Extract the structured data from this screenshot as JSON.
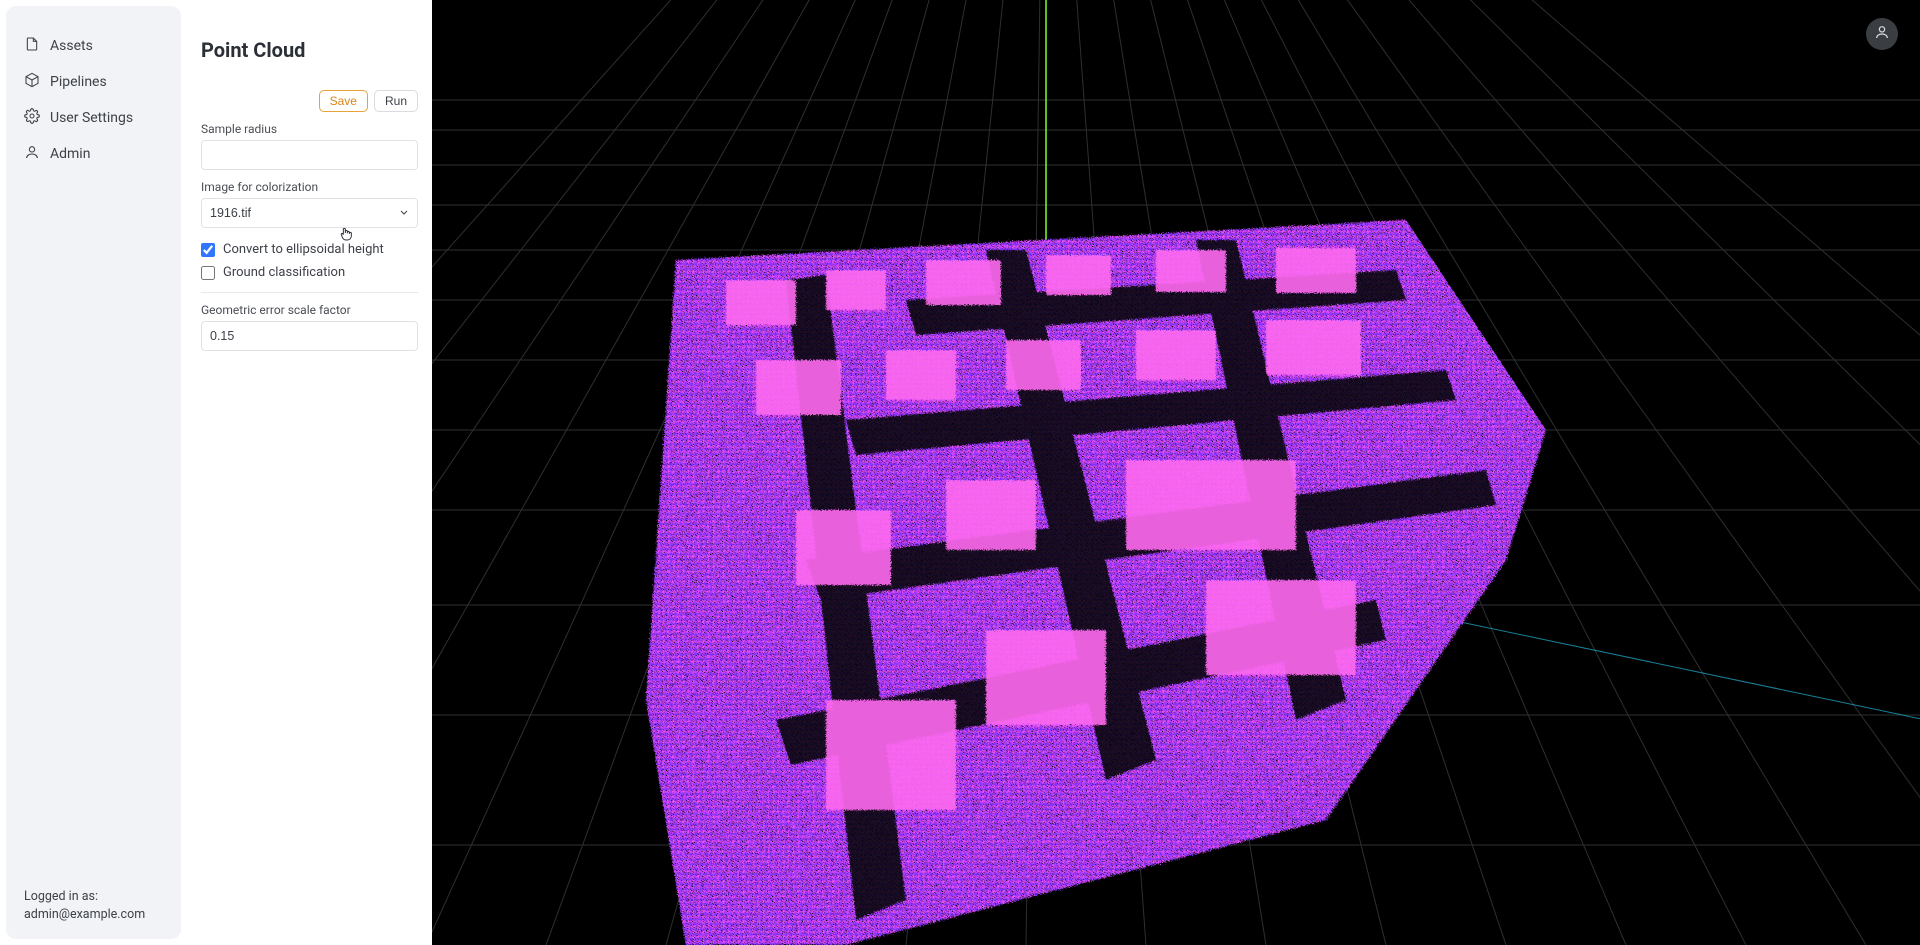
{
  "nav": {
    "items": [
      {
        "label": "Assets",
        "icon": "file-icon"
      },
      {
        "label": "Pipelines",
        "icon": "cube-icon"
      },
      {
        "label": "User Settings",
        "icon": "gear-icon"
      },
      {
        "label": "Admin",
        "icon": "user-icon"
      }
    ],
    "footer_line1": "Logged in as:",
    "footer_line2": "admin@example.com"
  },
  "panel": {
    "title": "Point Cloud",
    "save_label": "Save",
    "run_label": "Run",
    "sample_radius_label": "Sample radius",
    "sample_radius_value": "",
    "image_label": "Image for colorization",
    "image_value": "1916.tif",
    "convert_label": "Convert to ellipsoidal height",
    "convert_checked": true,
    "ground_label": "Ground classification",
    "ground_checked": false,
    "geo_error_label": "Geometric error scale factor",
    "geo_error_value": "0.15"
  }
}
